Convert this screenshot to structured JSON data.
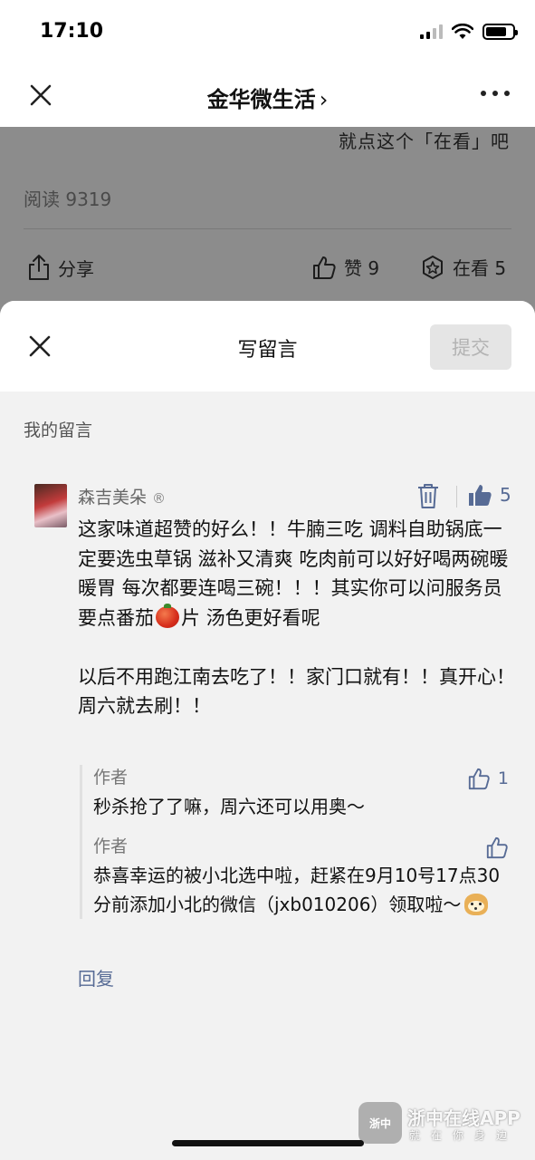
{
  "status_bar": {
    "time": "17:10"
  },
  "navbar": {
    "title": "金华微生活",
    "chevron": "›"
  },
  "article": {
    "hint": "就点这个「在看」吧",
    "read_count": "阅读 9319",
    "share_label": "分享",
    "like_label": "赞 9",
    "watching_label": "在看 5"
  },
  "sheet": {
    "title": "写留言",
    "submit_label": "提交",
    "my_comments_label": "我的留言"
  },
  "comment": {
    "author": "森吉美朵",
    "registered_mark": "®",
    "like_count": "5",
    "body_part1": "这家味道超赞的好么！！牛腩三吃 调料自助锅底一定要选虫草锅 滋补又清爽 吃肉前可以好好喝两碗暖暖胃 每次都要连喝三碗！！！其实你可以问服务员要点番茄",
    "body_part2": "片 汤色更好看呢\n\n以后不用跑江南去吃了！！家门口就有！！真开心！周六就去刷！！",
    "replies": [
      {
        "author": "作者",
        "text": "秒杀抢了了嘛，周六还可以用奥～",
        "likes": "1"
      },
      {
        "author": "作者",
        "text": "恭喜幸运的被小北选中啦，赶紧在9月10号17点30分前添加小北的微信（jxb010206）领取啦～",
        "likes": ""
      }
    ],
    "reply_link": "回复"
  },
  "watermark": {
    "logo_text": "浙中",
    "name": "浙中在线APP",
    "slogan": "就在你身边"
  },
  "icons": [
    "close-icon",
    "more-icon",
    "share-icon",
    "thumb-up-icon",
    "watching-icon",
    "trash-icon",
    "thumb-up-filled-icon",
    "tomato-emoji",
    "doge-emoji"
  ],
  "colors": {
    "link": "#576b95",
    "submit_disabled_bg": "#e5e5e5",
    "submit_disabled_text": "#b3b3b3"
  }
}
